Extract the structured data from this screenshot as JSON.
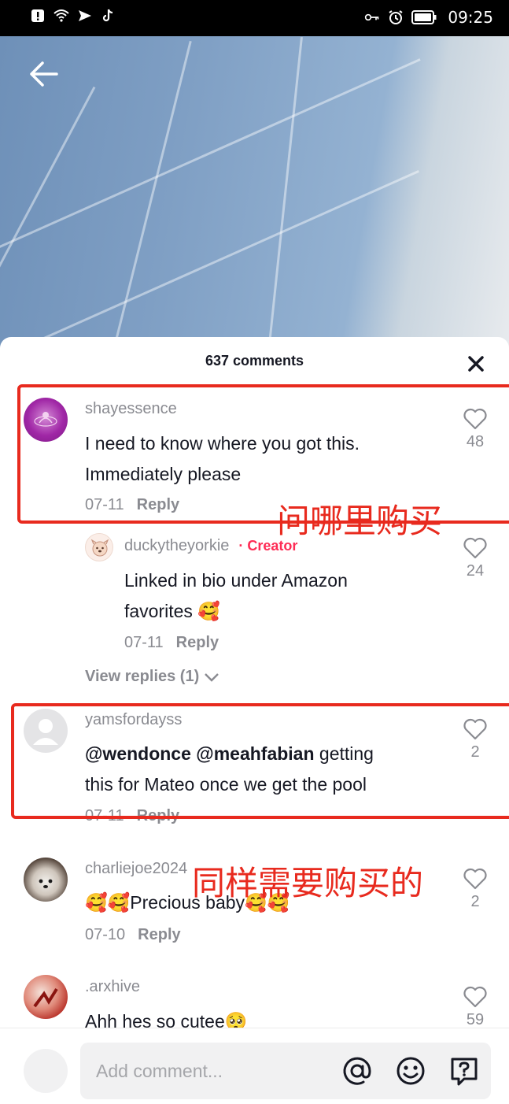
{
  "status_bar": {
    "time": "09:25"
  },
  "comments_header": {
    "title": "637 comments"
  },
  "comments": [
    {
      "username": "shayessence",
      "text_lines": [
        "I need to know where you got this.",
        "Immediately please"
      ],
      "date": "07-11",
      "reply_label": "Reply",
      "likes": "48"
    },
    {
      "username": "duckytheyorkie",
      "creator_badge": "· Creator",
      "text_lines": [
        "Linked in bio under Amazon",
        "favorites 🥰"
      ],
      "date": "07-11",
      "reply_label": "Reply",
      "likes": "24"
    },
    {
      "username": "yamsfordayss",
      "mentions": [
        "@wendonce",
        "@meahfabian"
      ],
      "text_line1_rest": " getting",
      "text_line2": "this for Mateo once we get the pool",
      "date": "07-11",
      "reply_label": "Reply",
      "likes": "2"
    },
    {
      "username": "charliejoe2024",
      "text_lines": [
        "🥰🥰Precious baby🥰🥰"
      ],
      "date": "07-10",
      "reply_label": "Reply",
      "likes": "2"
    },
    {
      "username": ".arxhive",
      "text_lines": [
        "Ahh hes so cutee🥺"
      ],
      "likes": "59"
    }
  ],
  "view_replies": "View replies (1)",
  "annotations": {
    "label1": "问哪里购买",
    "label2": "同样需要购买的"
  },
  "input": {
    "placeholder": "Add comment..."
  },
  "colors": {
    "accent": "#fe2c55",
    "annotation": "#e82a1e",
    "muted": "#8a8b91"
  }
}
